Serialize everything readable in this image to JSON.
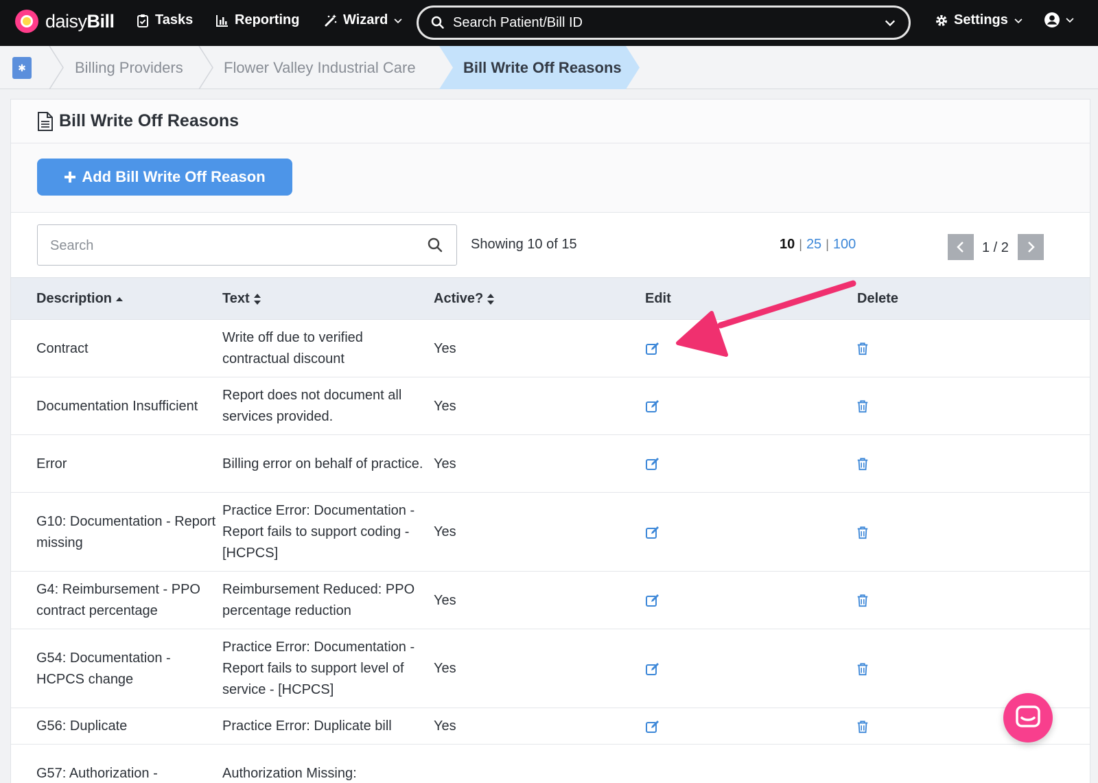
{
  "app": {
    "logo_prefix": "daisy",
    "logo_suffix": "Bill"
  },
  "nav": {
    "tasks": "Tasks",
    "reporting": "Reporting",
    "wizard": "Wizard",
    "search_placeholder": "Search Patient/Bill ID",
    "settings": "Settings"
  },
  "breadcrumb": {
    "items": [
      "Billing Providers",
      "Flower Valley Industrial Care"
    ],
    "active": "Bill Write Off Reasons"
  },
  "card": {
    "title": "Bill Write Off Reasons",
    "add_button": "Add Bill Write Off Reason",
    "search_placeholder": "Search",
    "showing": "Showing 10 of 15",
    "page_sizes": [
      "10",
      "25",
      "100"
    ],
    "page_size_selected": "10",
    "page": "1 / 2"
  },
  "table": {
    "headers": {
      "description": "Description",
      "text": "Text",
      "active": "Active?",
      "edit": "Edit",
      "delete": "Delete"
    },
    "rows": [
      {
        "description": "Contract",
        "text": "Write off due to verified contractual discount",
        "active": "Yes"
      },
      {
        "description": "Documentation Insufficient",
        "text": "Report does not document all services provided.",
        "active": "Yes"
      },
      {
        "description": "Error",
        "text": "Billing error on behalf of practice.",
        "active": "Yes"
      },
      {
        "description": "G10: Documentation - Report missing",
        "text": "Practice Error: Documentation - Report fails to support coding - [HCPCS]",
        "active": "Yes"
      },
      {
        "description": "G4: Reimbursement - PPO contract percentage",
        "text": "Reimbursement Reduced: PPO percentage reduction",
        "active": "Yes"
      },
      {
        "description": "G54: Documentation - HCPCS change",
        "text": "Practice Error: Documentation - Report fails to support level of service - [HCPCS]",
        "active": "Yes"
      },
      {
        "description": "G56: Duplicate",
        "text": "Practice Error: Duplicate bill",
        "active": "Yes"
      },
      {
        "description": "G57: Authorization -",
        "text": "Authorization Missing:",
        "active": ""
      }
    ]
  },
  "colors": {
    "accent": "#4d95e8",
    "link": "#3c87d8",
    "annotation_arrow": "#f0306f",
    "breadcrumb_active": "#c5e2fb"
  }
}
